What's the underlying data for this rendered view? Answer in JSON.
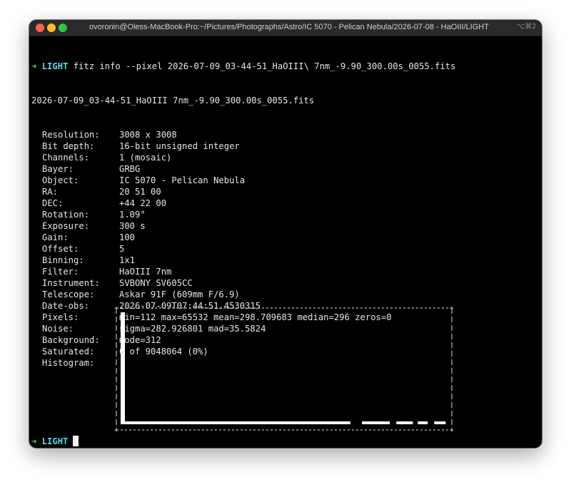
{
  "window": {
    "title": "ovoronin@Oless-MacBook-Pro:~/Pictures/Photographs/Astro/IC 5070 - Pelican Nebula/2026-07-08 - HaOIII/LIGHT",
    "shortcut": "⌥⌘2"
  },
  "prompt": {
    "arrow": "➜",
    "dir": "LIGHT",
    "command": "fitz info --pixel 2026-07-09_03-44-51_HaOIII\\ 7nm_-9.90_300.00s_0055.fits"
  },
  "output": {
    "filename": "2026-07-09_03-44-51_HaOIII 7nm_-9.90_300.00s_0055.fits",
    "rows": [
      {
        "label": "Resolution:",
        "value": "3008 x 3008"
      },
      {
        "label": "Bit depth:",
        "value": "16-bit unsigned integer"
      },
      {
        "label": "Channels:",
        "value": "1 (mosaic)"
      },
      {
        "label": "Bayer:",
        "value": "GRBG"
      },
      {
        "label": "Object:",
        "value": "IC 5070 - Pelican Nebula"
      },
      {
        "label": "RA:",
        "value": "20 51 00"
      },
      {
        "label": "DEC:",
        "value": "+44 22 00"
      },
      {
        "label": "Rotation:",
        "value": "1.09°"
      },
      {
        "label": "Exposure:",
        "value": "300 s"
      },
      {
        "label": "Gain:",
        "value": "100"
      },
      {
        "label": "Offset:",
        "value": "5"
      },
      {
        "label": "Binning:",
        "value": "1x1"
      },
      {
        "label": "Filter:",
        "value": "HaOIII 7nm"
      },
      {
        "label": "Instrument:",
        "value": "SVBONY SV605CC"
      },
      {
        "label": "Telescope:",
        "value": "Askar 91F (609mm F/6.9)"
      },
      {
        "label": "Date-obs:",
        "value": "2026-07-09T07:44:51.4530315"
      },
      {
        "label": "Pixels:",
        "value": "min=112 max=65532 mean=298.709683 median=296 zeros=0"
      },
      {
        "label": "Noise:",
        "value": "sigma=282.926801 mad=35.5824"
      },
      {
        "label": "Background:",
        "value": "mode=312"
      },
      {
        "label": "Saturated:",
        "value": "0 of 9048064 (0%)"
      },
      {
        "label": "Histogram:",
        "value": ""
      }
    ]
  },
  "histogram": {
    "spike_level": 1.0,
    "baseline_level": 0.045,
    "tail_segments": [
      {
        "from": 0.0,
        "to": 0.7
      },
      {
        "from": 0.735,
        "to": 0.82
      },
      {
        "from": 0.84,
        "to": 0.89
      },
      {
        "from": 0.905,
        "to": 0.935
      },
      {
        "from": 0.955,
        "to": 0.99
      }
    ]
  },
  "prompt2": {
    "arrow": "➜",
    "dir": "LIGHT"
  },
  "colors": {
    "background": "#000000",
    "text": "#e6e6e6",
    "arrow": "#4fe07a",
    "dir": "#5ed7e3",
    "titlebar": "#2a2a2a"
  }
}
